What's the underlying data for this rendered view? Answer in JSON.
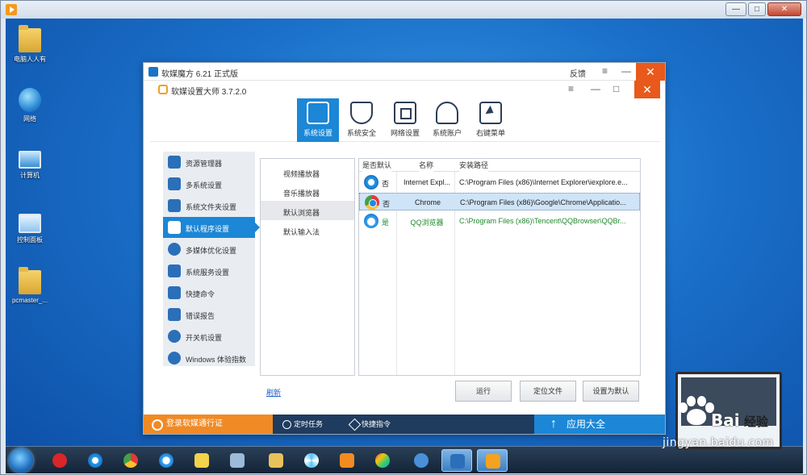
{
  "outer_window": {
    "controls": {
      "minimize": "—",
      "maximize": "□",
      "close": "✕"
    }
  },
  "desktop": {
    "icons": [
      {
        "label": "电脑人人有",
        "type": "folder-icon"
      },
      {
        "label": "网络",
        "type": "network-icon"
      },
      {
        "label": "计算机",
        "type": "computer-icon"
      },
      {
        "label": "控制面板",
        "type": "control-panel-icon"
      },
      {
        "label": "pcmaster_...",
        "type": "folder-icon"
      }
    ]
  },
  "app": {
    "outer_title": "软媒魔方 6.21 正式版",
    "feedback": "反馈",
    "menu_glyph": "≡",
    "min_glyph": "—",
    "max_glyph": "□",
    "close_glyph": "✕",
    "inner_title": "软媒设置大师 3.7.2.0",
    "toolbar": [
      {
        "label": "系统设置",
        "icon": "system-settings-icon",
        "active": true
      },
      {
        "label": "系统安全",
        "icon": "shield-icon",
        "active": false
      },
      {
        "label": "网络设置",
        "icon": "network-settings-icon",
        "active": false
      },
      {
        "label": "系统账户",
        "icon": "user-account-icon",
        "active": false
      },
      {
        "label": "右键菜单",
        "icon": "context-menu-icon",
        "active": false
      }
    ],
    "left_nav": [
      {
        "label": "资源管理器",
        "icon": "explorer-icon"
      },
      {
        "label": "多系统设置",
        "icon": "multi-system-icon"
      },
      {
        "label": "系统文件夹设置",
        "icon": "system-folder-icon"
      },
      {
        "label": "默认程序设置",
        "icon": "default-program-icon",
        "active": true
      },
      {
        "label": "多媒体优化设置",
        "icon": "multimedia-icon"
      },
      {
        "label": "系统服务设置",
        "icon": "system-service-icon"
      },
      {
        "label": "快捷命令",
        "icon": "shortcut-command-icon"
      },
      {
        "label": "错误报告",
        "icon": "error-report-icon"
      },
      {
        "label": "开关机设置",
        "icon": "power-icon"
      },
      {
        "label": "Windows 体验指数",
        "icon": "experience-index-icon"
      }
    ],
    "sub_list": [
      {
        "label": "视频播放器"
      },
      {
        "label": "音乐播放器"
      },
      {
        "label": "默认浏览器",
        "active": true
      },
      {
        "label": "默认输入法"
      }
    ],
    "table": {
      "headers": [
        "是否默认",
        "名称",
        "安装路径"
      ],
      "rows": [
        {
          "is_default": "否",
          "name": "Internet Expl...",
          "path": "C:\\Program Files (x86)\\Internet Explorer\\iexplore.e...",
          "icon": "ie-icon",
          "selected": false,
          "highlight": false
        },
        {
          "is_default": "否",
          "name": "Chrome",
          "path": "C:\\Program Files (x86)\\Google\\Chrome\\Applicatio...",
          "icon": "chrome-icon",
          "selected": true,
          "highlight": false
        },
        {
          "is_default": "是",
          "name": "QQ浏览器",
          "path": "C:\\Program Files (x86)\\Tencent\\QQBrowser\\QQBr...",
          "icon": "qq-browser-icon",
          "selected": false,
          "highlight": true
        }
      ]
    },
    "refresh": "刷新",
    "buttons": {
      "run": "运行",
      "locate": "定位文件",
      "set_default": "设置为默认"
    },
    "bottom": {
      "login": "登录软媒通行证",
      "timer": "定时任务",
      "quick": "快捷指令",
      "app_market": "应用大全"
    }
  },
  "taskbar": {
    "items": [
      "start-orb-icon",
      "jiang-icon",
      "ie-icon",
      "chrome-icon",
      "qq-browser-icon",
      "sticky-notes-icon",
      "device-icon",
      "folder-icon",
      "pinwheel-icon",
      "media-player-icon",
      "paint-icon",
      "network-tool-icon",
      "ruanmei-cube-icon",
      "settings-master-icon"
    ]
  },
  "watermark": {
    "brand": "Bai",
    "suffix": "经验",
    "url": "jingyan.baidu.com"
  },
  "colors": {
    "accent": "#1b87d6",
    "orange": "#f08a24",
    "close_red": "#e8591b",
    "default_green": "#1f8a2b"
  }
}
